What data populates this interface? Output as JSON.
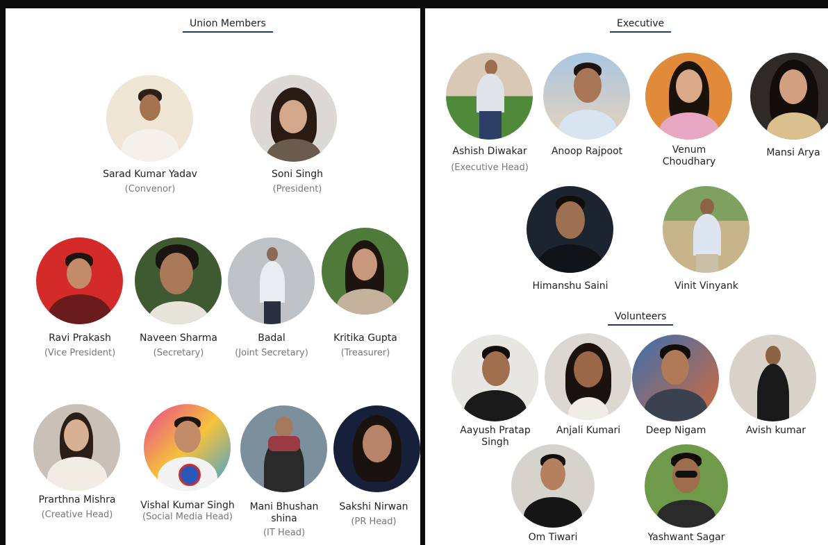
{
  "sections": {
    "union": "Union Members",
    "executive": "Executive",
    "volunteers": "Volunteers"
  },
  "union_members": [
    {
      "name": "Sarad Kumar Yadav",
      "role": "(Convenor)"
    },
    {
      "name": "Soni Singh",
      "role": "(President)"
    },
    {
      "name": "Ravi Prakash",
      "role": "(Vice President)"
    },
    {
      "name": "Naveen Sharma",
      "role": "(Secretary)"
    },
    {
      "name": "Badal",
      "role": "(Joint Secretary)"
    },
    {
      "name": "Kritika Gupta",
      "role": "(Treasurer)"
    },
    {
      "name": "Prarthna Mishra",
      "role": "(Creative Head)"
    },
    {
      "name": "Vishal Kumar Singh",
      "role": "(Social Media Head)"
    },
    {
      "name": "Mani Bhushan\nshina",
      "role": "(IT Head)"
    },
    {
      "name": "Sakshi Nirwan",
      "role": "(PR Head)"
    }
  ],
  "executive_members": [
    {
      "name": "Ashish Diwakar",
      "role": "(Executive Head)"
    },
    {
      "name": "Anoop Rajpoot",
      "role": ""
    },
    {
      "name": "Venum\nChoudhary",
      "role": ""
    },
    {
      "name": "Mansi Arya",
      "role": ""
    },
    {
      "name": "Himanshu Saini",
      "role": ""
    },
    {
      "name": "Vinit Vinyank",
      "role": ""
    }
  ],
  "volunteers": [
    {
      "name": "Aayush Pratap\nSingh",
      "role": ""
    },
    {
      "name": "Anjali Kumari",
      "role": ""
    },
    {
      "name": "Deep Nigam",
      "role": ""
    },
    {
      "name": "Avish kumar",
      "role": ""
    },
    {
      "name": "Om Tiwari",
      "role": ""
    },
    {
      "name": "Yashwant Sagar",
      "role": ""
    }
  ],
  "colors": {
    "title_underline": "#1e3a6a",
    "border": "#0b0b0b"
  }
}
